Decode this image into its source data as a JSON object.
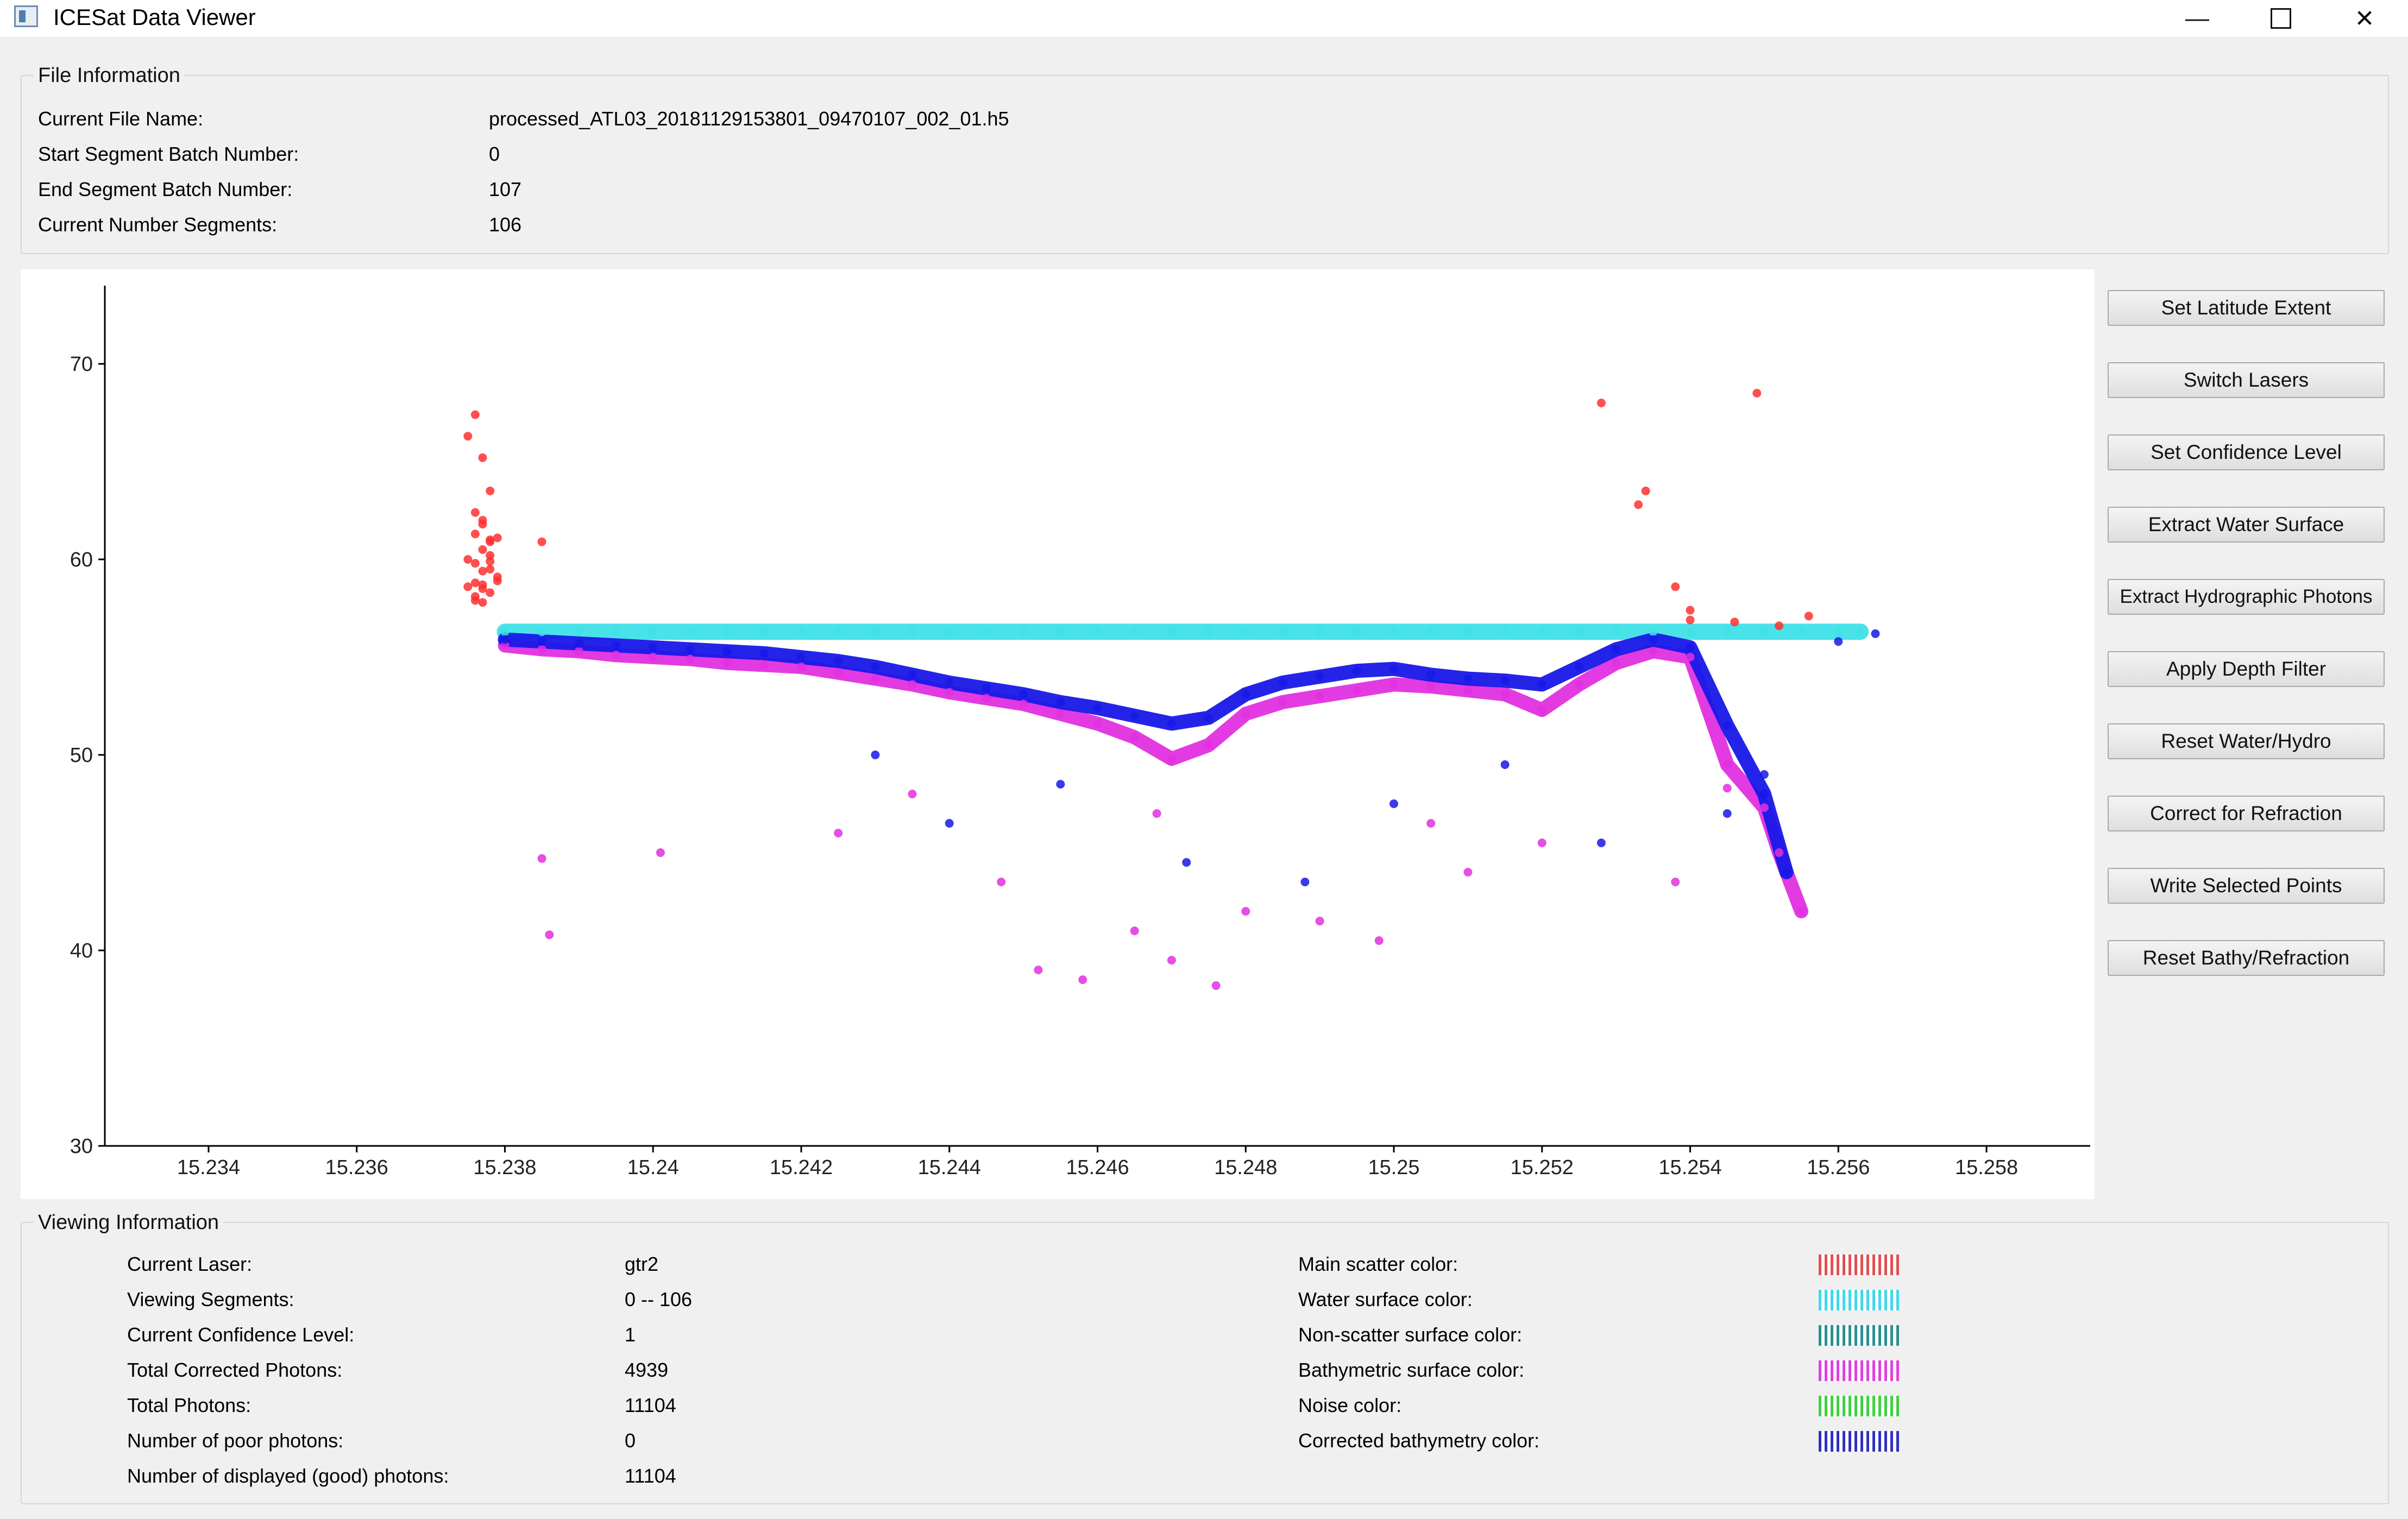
{
  "window": {
    "title": "ICESat Data Viewer",
    "minimize": "—",
    "close": "✕"
  },
  "file_info": {
    "group_title": "File Information",
    "rows": [
      {
        "label": "Current File Name:",
        "value": "processed_ATL03_20181129153801_09470107_002_01.h5"
      },
      {
        "label": "Start Segment Batch Number:",
        "value": "0"
      },
      {
        "label": "End Segment Batch Number:",
        "value": "107"
      },
      {
        "label": "Current Number Segments:",
        "value": "106"
      }
    ]
  },
  "buttons": [
    "Set Latitude Extent",
    "Switch Lasers",
    "Set Confidence Level",
    "Extract Water Surface",
    "Extract Hydrographic Photons",
    "Apply Depth Filter",
    "Reset Water/Hydro",
    "Correct for Refraction",
    "Write Selected Points",
    "Reset Bathy/Refraction"
  ],
  "viewing_info": {
    "group_title": "Viewing Information",
    "rows": [
      {
        "label": "Current Laser:",
        "value": "gtr2"
      },
      {
        "label": "Viewing Segments:",
        "value": "0 -- 106"
      },
      {
        "label": "Current Confidence Level:",
        "value": "1"
      },
      {
        "label": "Total Corrected Photons:",
        "value": "4939"
      },
      {
        "label": "Total Photons:",
        "value": "11104"
      },
      {
        "label": "Number of poor photons:",
        "value": "0"
      },
      {
        "label": "Number of displayed (good) photons:",
        "value": "11104"
      }
    ],
    "colors": [
      {
        "label": "Main scatter color:",
        "color": "#e05050"
      },
      {
        "label": "Water surface color:",
        "color": "#40d8e8"
      },
      {
        "label": "Non-scatter surface color:",
        "color": "#2a9090"
      },
      {
        "label": "Bathymetric surface color:",
        "color": "#e040e0"
      },
      {
        "label": "Noise color:",
        "color": "#40d040"
      },
      {
        "label": "Corrected bathymetry color:",
        "color": "#3030c0"
      }
    ]
  },
  "chart_data": {
    "type": "scatter",
    "title": "",
    "xlabel": "",
    "ylabel": "",
    "xlim": [
      15.2326,
      15.2594
    ],
    "ylim": [
      30,
      74
    ],
    "x_ticks": [
      "15.234",
      "15.236",
      "15.238",
      "15.24",
      "15.242",
      "15.244",
      "15.246",
      "15.248",
      "15.25",
      "15.252",
      "15.254",
      "15.256",
      "15.258"
    ],
    "x_tick_values": [
      15.234,
      15.236,
      15.238,
      15.24,
      15.242,
      15.244,
      15.246,
      15.248,
      15.25,
      15.252,
      15.254,
      15.256,
      15.258
    ],
    "y_ticks": [
      "30",
      "40",
      "50",
      "60",
      "70"
    ],
    "y_tick_values": [
      30,
      40,
      50,
      60,
      70
    ],
    "grid": false,
    "series": [
      {
        "color": "#ff3030",
        "x": [
          15.2375,
          15.2376,
          15.2377,
          15.2378,
          15.2376,
          15.2377,
          15.2378,
          15.2377,
          15.2375,
          15.2376,
          15.2378,
          15.2379,
          15.2376,
          15.2377,
          15.2378,
          15.2376,
          15.2377,
          15.2379,
          15.2378,
          15.2377,
          15.2376,
          15.2378,
          15.2375,
          15.2377,
          15.2378,
          15.2379,
          15.2376,
          15.2377,
          15.2385,
          15.2528,
          15.2534,
          15.2549,
          15.2538,
          15.2533,
          15.254,
          15.2546,
          15.2556,
          15.254,
          15.2552
        ],
        "y": [
          66.3,
          67.4,
          65.2,
          63.5,
          62.4,
          61.8,
          61.0,
          60.5,
          60.0,
          59.8,
          59.5,
          59.1,
          58.8,
          58.5,
          58.3,
          58.1,
          57.8,
          58.9,
          60.9,
          62.0,
          61.3,
          59.9,
          58.6,
          59.4,
          60.2,
          61.1,
          57.9,
          58.7,
          60.9,
          68.0,
          63.5,
          68.5,
          58.6,
          62.8,
          57.4,
          56.8,
          57.1,
          56.9,
          56.6
        ]
      },
      {
        "color": "#40e0e8",
        "x": [
          15.238,
          15.2385,
          15.239,
          15.2395,
          15.24,
          15.2405,
          15.241,
          15.2415,
          15.242,
          15.2425,
          15.243,
          15.2435,
          15.244,
          15.2445,
          15.245,
          15.2455,
          15.246,
          15.2465,
          15.247,
          15.2475,
          15.248,
          15.2485,
          15.249,
          15.2495,
          15.25,
          15.2505,
          15.251,
          15.2515,
          15.252,
          15.2525,
          15.253,
          15.2535,
          15.254,
          15.2545,
          15.255,
          15.2555,
          15.256,
          15.2563
        ],
        "y": [
          56.3,
          56.3,
          56.3,
          56.3,
          56.3,
          56.3,
          56.3,
          56.3,
          56.3,
          56.3,
          56.3,
          56.3,
          56.3,
          56.3,
          56.3,
          56.3,
          56.3,
          56.3,
          56.3,
          56.3,
          56.3,
          56.3,
          56.3,
          56.3,
          56.3,
          56.3,
          56.3,
          56.3,
          56.3,
          56.3,
          56.3,
          56.3,
          56.3,
          56.3,
          56.3,
          56.3,
          56.3,
          56.3
        ]
      },
      {
        "color": "#e030e0",
        "x": [
          15.238,
          15.2385,
          15.239,
          15.2395,
          15.24,
          15.2405,
          15.241,
          15.2415,
          15.242,
          15.2425,
          15.243,
          15.2435,
          15.244,
          15.2445,
          15.245,
          15.2455,
          15.246,
          15.2465,
          15.247,
          15.2475,
          15.248,
          15.2485,
          15.249,
          15.2495,
          15.25,
          15.2505,
          15.251,
          15.2515,
          15.252,
          15.2525,
          15.253,
          15.2535,
          15.254,
          15.2545,
          15.255,
          15.2552,
          15.2555,
          15.2386,
          15.2425,
          15.2435,
          15.2452,
          15.2458,
          15.2465,
          15.247,
          15.2476,
          15.249,
          15.2498,
          15.251,
          15.252,
          15.2447,
          15.2468,
          15.248,
          15.2385,
          15.2401,
          15.2505,
          15.2538,
          15.2545
        ],
        "y": [
          55.6,
          55.4,
          55.3,
          55.1,
          55.0,
          54.9,
          54.7,
          54.6,
          54.5,
          54.2,
          53.9,
          53.6,
          53.2,
          52.9,
          52.6,
          52.1,
          51.6,
          50.9,
          49.8,
          50.5,
          52.1,
          52.7,
          53.0,
          53.3,
          53.6,
          53.5,
          53.3,
          53.1,
          52.3,
          53.6,
          54.7,
          55.3,
          55.0,
          49.5,
          47.3,
          45.0,
          42.0,
          40.8,
          46.0,
          48.0,
          39.0,
          38.5,
          41.0,
          39.5,
          38.2,
          41.5,
          40.5,
          44.0,
          45.5,
          43.5,
          47.0,
          42.0,
          44.7,
          45.0,
          46.5,
          43.5,
          48.3
        ]
      },
      {
        "color": "#1818e8",
        "x": [
          15.238,
          15.2385,
          15.239,
          15.2395,
          15.24,
          15.2405,
          15.241,
          15.2415,
          15.242,
          15.2425,
          15.243,
          15.2435,
          15.244,
          15.2445,
          15.245,
          15.2455,
          15.246,
          15.2465,
          15.247,
          15.2475,
          15.248,
          15.2485,
          15.249,
          15.2495,
          15.25,
          15.2505,
          15.251,
          15.2515,
          15.252,
          15.2525,
          15.253,
          15.2535,
          15.254,
          15.2545,
          15.255,
          15.2553,
          15.256,
          15.2565,
          15.243,
          15.244,
          15.2455,
          15.2472,
          15.2488,
          15.25,
          15.2515,
          15.2528,
          15.2545,
          15.255
        ],
        "y": [
          55.9,
          55.8,
          55.7,
          55.6,
          55.5,
          55.4,
          55.3,
          55.2,
          55.0,
          54.8,
          54.5,
          54.1,
          53.7,
          53.4,
          53.1,
          52.7,
          52.4,
          52.0,
          51.6,
          51.9,
          53.1,
          53.7,
          54.0,
          54.3,
          54.4,
          54.1,
          53.9,
          53.8,
          53.6,
          54.5,
          55.4,
          55.9,
          55.5,
          51.5,
          48.0,
          44.0,
          55.8,
          56.2,
          50.0,
          46.5,
          48.5,
          44.5,
          43.5,
          47.5,
          49.5,
          45.5,
          47.0,
          49.0
        ]
      }
    ]
  }
}
